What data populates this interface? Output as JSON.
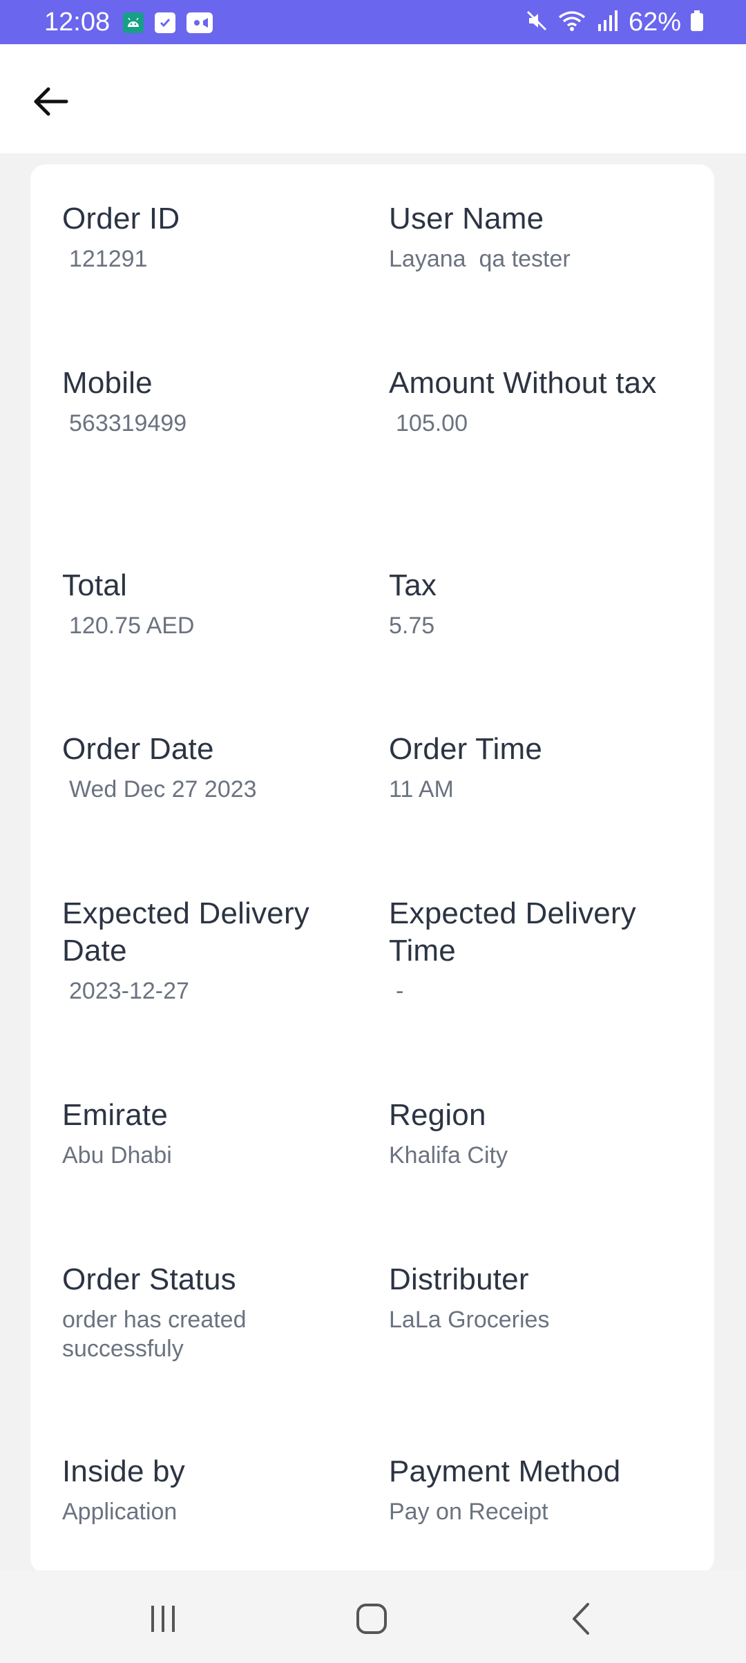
{
  "status_bar": {
    "time": "12:08",
    "battery": "62%",
    "icons_left": [
      "android-icon",
      "check-icon",
      "video-icon"
    ],
    "icons_right": [
      "mute-icon",
      "wifi-icon",
      "signal-icon",
      "battery-icon"
    ]
  },
  "header": {
    "back_icon": "back-arrow-icon"
  },
  "fields": {
    "order_id": {
      "label": "Order ID",
      "value": "121291"
    },
    "user_name": {
      "label": "User Name",
      "value": "Layana  qa tester"
    },
    "mobile": {
      "label": "Mobile",
      "value": "563319499"
    },
    "amount_without_tax": {
      "label": "Amount Without tax",
      "value": "105.00"
    },
    "total": {
      "label": "Total",
      "value": "120.75 AED"
    },
    "tax": {
      "label": "Tax",
      "value": "5.75"
    },
    "order_date": {
      "label": "Order Date",
      "value": "Wed Dec 27 2023"
    },
    "order_time": {
      "label": "Order Time",
      "value": "11 AM"
    },
    "expected_delivery_date": {
      "label": "Expected Delivery Date",
      "value": "2023-12-27"
    },
    "expected_delivery_time": {
      "label": "Expected Delivery Time",
      "value": "-"
    },
    "emirate": {
      "label": "Emirate",
      "value": "Abu Dhabi"
    },
    "region": {
      "label": "Region",
      "value": "Khalifa City"
    },
    "order_status": {
      "label": "Order Status",
      "value": "order has created successfuly"
    },
    "distributer": {
      "label": "Distributer",
      "value": "LaLa Groceries"
    },
    "inside_by": {
      "label": "Inside by",
      "value": "Application"
    },
    "payment_method": {
      "label": "Payment Method",
      "value": "Pay on Receipt"
    }
  },
  "nav_bar": {
    "buttons": [
      "recent-apps-icon",
      "home-icon",
      "back-icon"
    ]
  }
}
